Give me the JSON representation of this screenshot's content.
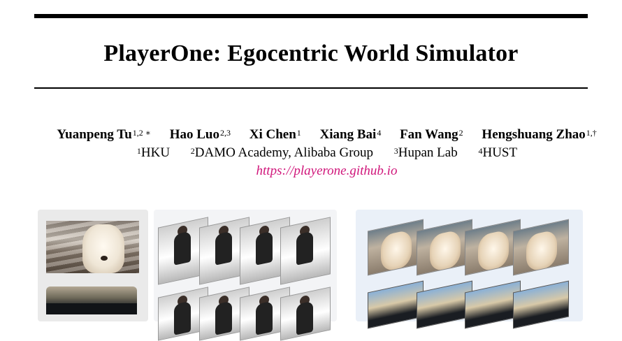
{
  "paper": {
    "title": "PlayerOne: Egocentric World Simulator",
    "authors": [
      {
        "name": "Yuanpeng Tu",
        "sup": "1,2 ∗"
      },
      {
        "name": "Hao Luo",
        "sup": "2,3"
      },
      {
        "name": "Xi Chen",
        "sup": "1"
      },
      {
        "name": "Xiang Bai",
        "sup": "4"
      },
      {
        "name": "Fan Wang",
        "sup": "2"
      },
      {
        "name": "Hengshuang Zhao",
        "sup": "1,†"
      }
    ],
    "affiliations": [
      {
        "sup": "1",
        "name": "HKU"
      },
      {
        "sup": "2",
        "name": "DAMO Academy, Alibaba Group"
      },
      {
        "sup": "3",
        "name": "Hupan Lab"
      },
      {
        "sup": "4",
        "name": "HUST"
      }
    ],
    "project_url": "https://playerone.github.io"
  },
  "colors": {
    "link": "#d0157a",
    "rule": "#000000"
  }
}
